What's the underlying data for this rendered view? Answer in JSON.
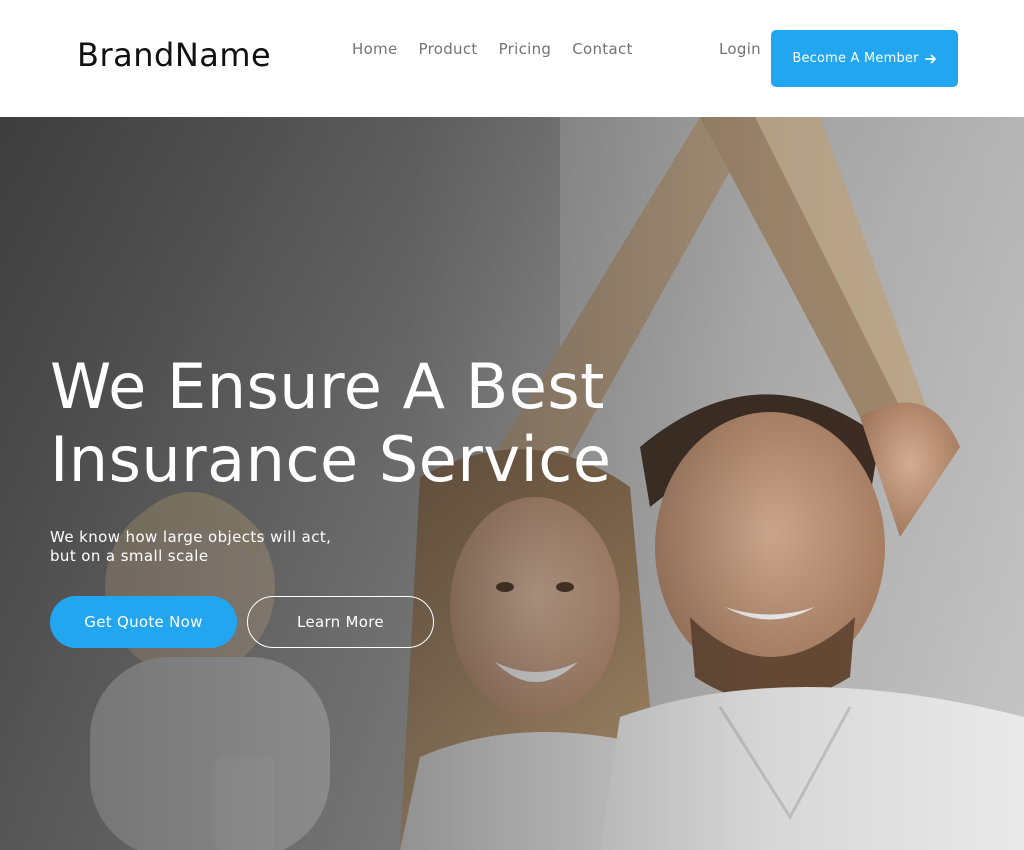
{
  "header": {
    "brand": "BrandName",
    "nav": [
      {
        "label": "Home"
      },
      {
        "label": "Product"
      },
      {
        "label": "Pricing"
      },
      {
        "label": "Contact"
      }
    ],
    "login_label": "Login",
    "member_button_label": "Become A Member",
    "member_button_icon": "arrow-right-icon"
  },
  "hero": {
    "title_line1": "We Ensure A Best",
    "title_line2": "Insurance Service",
    "subtitle_line1": "We know how large objects will act,",
    "subtitle_line2": "but on a small scale",
    "primary_button_label": "Get Quote Now",
    "secondary_button_label": "Learn More",
    "image": "family-under-cardboard-roof-photo"
  },
  "colors": {
    "accent": "#23a6f0",
    "nav_text": "#737373",
    "brand_text": "#111111",
    "hero_text": "#ffffff"
  }
}
